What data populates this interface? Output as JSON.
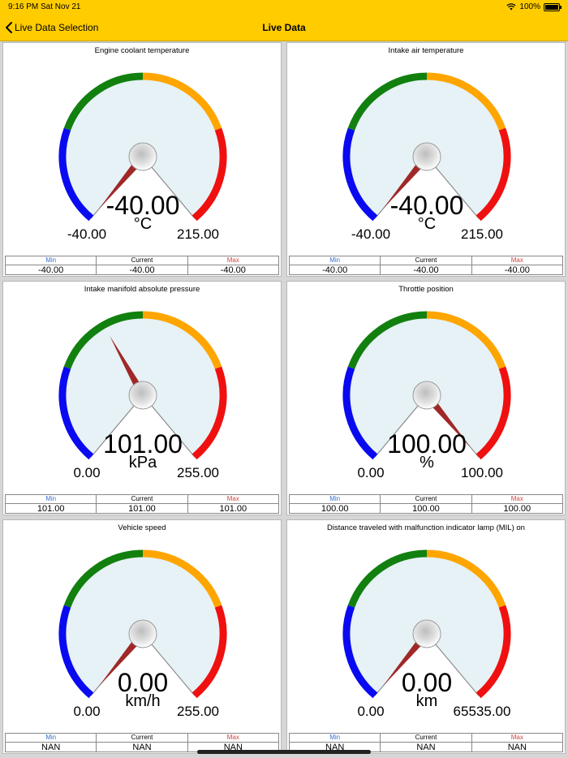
{
  "status_bar": {
    "time": "9:16 PM",
    "date": "Sat Nov 21",
    "battery": "100%",
    "wifi_icon": "wifi-icon",
    "battery_icon": "battery-icon"
  },
  "nav": {
    "back_label": "Live Data Selection",
    "back_icon": "chevron-left-icon",
    "title": "Live Data"
  },
  "colors": {
    "bar": "#ffcc00",
    "gauge_face": "#e6f2f6",
    "arc_blue": "#0a0af0",
    "arc_green": "#12800f",
    "arc_orange": "#ffa500",
    "arc_red": "#f01010",
    "needle": "#a02828"
  },
  "stats_labels": {
    "min": "Min",
    "current": "Current",
    "max": "Max"
  },
  "gauges": [
    {
      "title": "Engine coolant temperature",
      "value": "-40.00",
      "unit": "°C",
      "range_min": "-40.00",
      "range_max": "215.00",
      "needle_fraction": 0,
      "min": "-40.00",
      "current": "-40.00",
      "max": "-40.00"
    },
    {
      "title": "Intake air temperature",
      "value": "-40.00",
      "unit": "°C",
      "range_min": "-40.00",
      "range_max": "215.00",
      "needle_fraction": 0,
      "min": "-40.00",
      "current": "-40.00",
      "max": "-40.00"
    },
    {
      "title": "Intake manifold absolute pressure",
      "value": "101.00",
      "unit": "kPa",
      "range_min": "0.00",
      "range_max": "255.00",
      "needle_fraction": 0.396,
      "min": "101.00",
      "current": "101.00",
      "max": "101.00"
    },
    {
      "title": "Throttle position",
      "value": "100.00",
      "unit": "%",
      "range_min": "0.00",
      "range_max": "100.00",
      "needle_fraction": 1,
      "min": "100.00",
      "current": "100.00",
      "max": "100.00"
    },
    {
      "title": "Vehicle speed",
      "value": "0.00",
      "unit": "km/h",
      "range_min": "0.00",
      "range_max": "255.00",
      "needle_fraction": 0,
      "min": "NAN",
      "current": "NAN",
      "max": "NAN"
    },
    {
      "title": "Distance traveled with malfunction indicator lamp (MIL) on",
      "value": "0.00",
      "unit": "km",
      "range_min": "0.00",
      "range_max": "65535.00",
      "needle_fraction": 0,
      "min": "NAN",
      "current": "NAN",
      "max": "NAN"
    }
  ]
}
